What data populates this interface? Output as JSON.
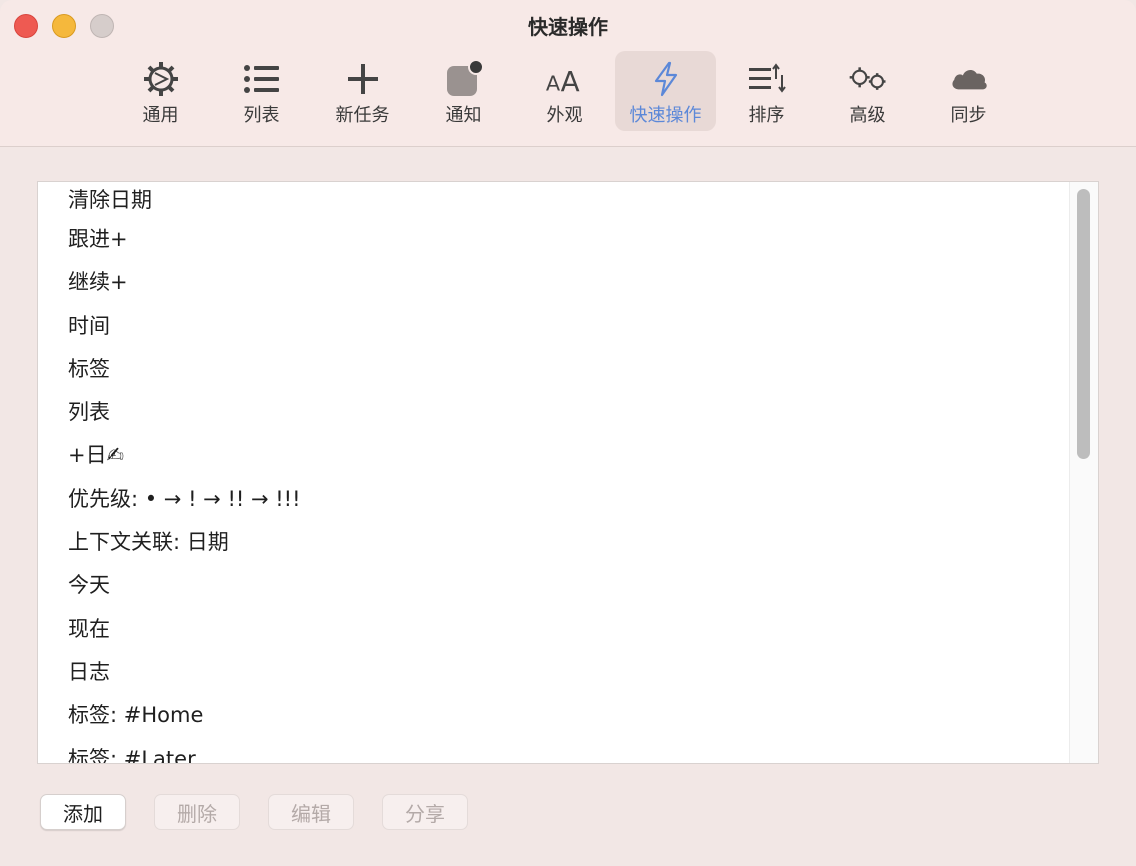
{
  "window": {
    "title": "快速操作"
  },
  "toolbar": {
    "items": [
      {
        "label": "通用",
        "icon": "gear-icon"
      },
      {
        "label": "列表",
        "icon": "list-icon"
      },
      {
        "label": "新任务",
        "icon": "plus-icon"
      },
      {
        "label": "通知",
        "icon": "notification-badge-icon"
      },
      {
        "label": "外观",
        "icon": "font-size-icon"
      },
      {
        "label": "快速操作",
        "icon": "lightning-icon",
        "active": true
      },
      {
        "label": "排序",
        "icon": "sort-icon"
      },
      {
        "label": "高级",
        "icon": "gears-icon"
      },
      {
        "label": "同步",
        "icon": "cloud-icon"
      }
    ],
    "active_color": "#5c88d8"
  },
  "actions": {
    "items": [
      "清除日期",
      "跟进+",
      "继续+",
      "时间",
      "标签",
      "列表",
      "+日✍",
      "优先级: • → ! → !! → !!!",
      "上下文关联: 日期",
      "今天",
      "现在",
      "日志",
      "标签: #Home",
      "标签: #Later"
    ]
  },
  "buttons": {
    "add": "添加",
    "delete": "删除",
    "edit": "编辑",
    "share": "分享"
  }
}
